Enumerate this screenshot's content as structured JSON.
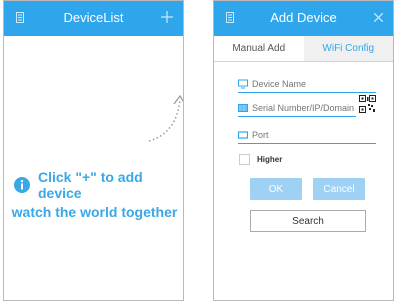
{
  "left_screen": {
    "title": "DeviceList",
    "hint_line1": "Click \"+\" to add device",
    "hint_line2": "watch the world together"
  },
  "right_screen": {
    "title": "Add Device",
    "tabs": [
      {
        "label": "Manual Add",
        "active": true
      },
      {
        "label": "WiFi Config",
        "active": false
      }
    ],
    "fields": {
      "device_name_placeholder": "Device Name",
      "serial_placeholder": "Serial Number/IP/Domain",
      "port_placeholder": "Port"
    },
    "checkbox_label": "Higher",
    "buttons": {
      "ok": "OK",
      "cancel": "Cancel",
      "search": "Search"
    }
  },
  "colors": {
    "accent": "#2fa6ec",
    "hint_text": "#3aa7e6",
    "button_disabled": "#9fd1f5"
  },
  "icons": [
    "menu-icon",
    "plus-icon",
    "info-icon",
    "close-icon",
    "monitor-icon",
    "barcode-icon",
    "port-icon",
    "qr-code-icon"
  ]
}
